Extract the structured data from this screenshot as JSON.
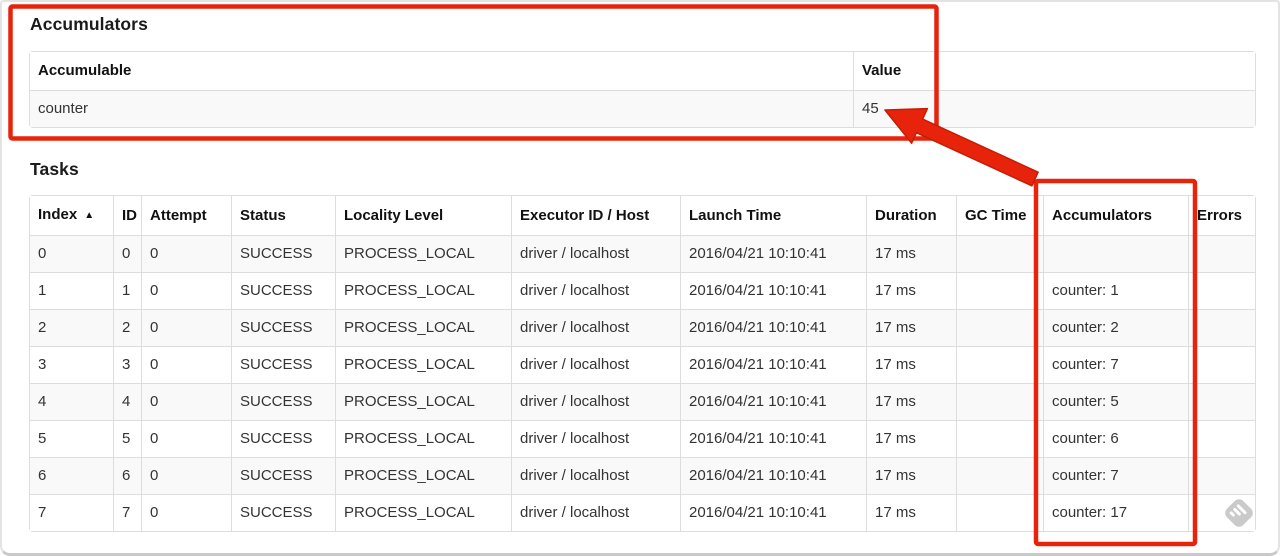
{
  "accumulators": {
    "title": "Accumulators",
    "headers": [
      "Accumulable",
      "Value"
    ],
    "rows": [
      {
        "accumulable": "counter",
        "value": "45"
      }
    ]
  },
  "tasks": {
    "title": "Tasks",
    "headers": [
      "Index",
      "ID",
      "Attempt",
      "Status",
      "Locality Level",
      "Executor ID / Host",
      "Launch Time",
      "Duration",
      "GC Time",
      "Accumulators",
      "Errors"
    ],
    "sort_indicator": "▲",
    "rows": [
      [
        "0",
        "0",
        "0",
        "SUCCESS",
        "PROCESS_LOCAL",
        "driver / localhost",
        "2016/04/21 10:10:41",
        "17 ms",
        "",
        "",
        ""
      ],
      [
        "1",
        "1",
        "0",
        "SUCCESS",
        "PROCESS_LOCAL",
        "driver / localhost",
        "2016/04/21 10:10:41",
        "17 ms",
        "",
        "counter: 1",
        ""
      ],
      [
        "2",
        "2",
        "0",
        "SUCCESS",
        "PROCESS_LOCAL",
        "driver / localhost",
        "2016/04/21 10:10:41",
        "17 ms",
        "",
        "counter: 2",
        ""
      ],
      [
        "3",
        "3",
        "0",
        "SUCCESS",
        "PROCESS_LOCAL",
        "driver / localhost",
        "2016/04/21 10:10:41",
        "17 ms",
        "",
        "counter: 7",
        ""
      ],
      [
        "4",
        "4",
        "0",
        "SUCCESS",
        "PROCESS_LOCAL",
        "driver / localhost",
        "2016/04/21 10:10:41",
        "17 ms",
        "",
        "counter: 5",
        ""
      ],
      [
        "5",
        "5",
        "0",
        "SUCCESS",
        "PROCESS_LOCAL",
        "driver / localhost",
        "2016/04/21 10:10:41",
        "17 ms",
        "",
        "counter: 6",
        ""
      ],
      [
        "6",
        "6",
        "0",
        "SUCCESS",
        "PROCESS_LOCAL",
        "driver / localhost",
        "2016/04/21 10:10:41",
        "17 ms",
        "",
        "counter: 7",
        ""
      ],
      [
        "7",
        "7",
        "0",
        "SUCCESS",
        "PROCESS_LOCAL",
        "driver / localhost",
        "2016/04/21 10:10:41",
        "17 ms",
        "",
        "counter: 17",
        ""
      ]
    ]
  },
  "annotations": {
    "color": "#e8230c",
    "arrow_edge_color": "#c51d05"
  },
  "watermark": {
    "color": "#cacaca"
  }
}
